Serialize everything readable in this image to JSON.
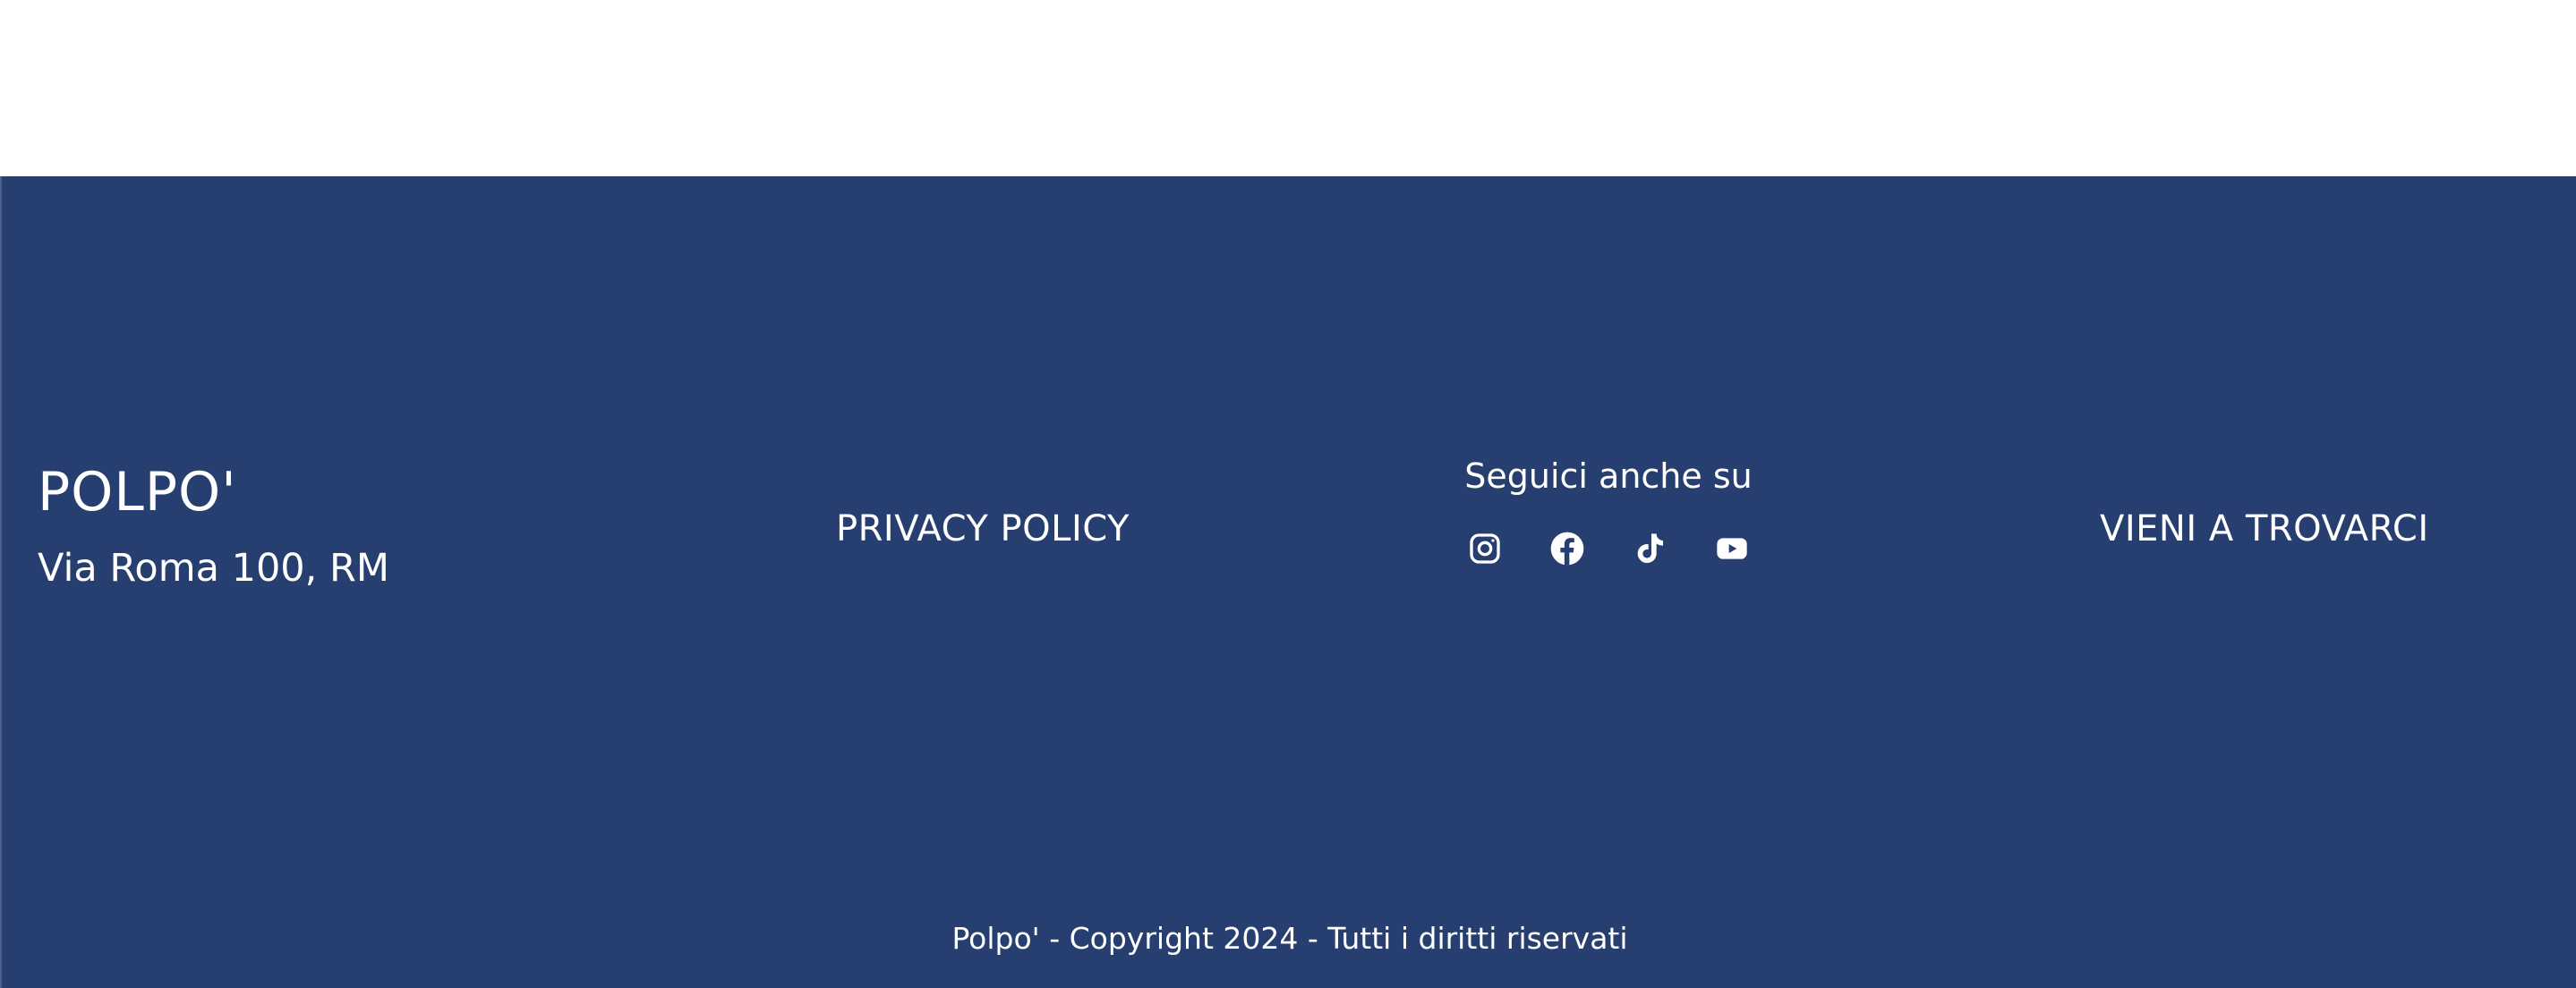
{
  "footer": {
    "brand": {
      "name": "POLPO'",
      "address": "Via Roma 100, RM"
    },
    "privacy_label": "PRIVACY POLICY",
    "social": {
      "title": "Seguici anche su",
      "icons": [
        "instagram-icon",
        "facebook-icon",
        "tiktok-icon",
        "youtube-icon"
      ]
    },
    "visit_label": "VIENI A TROVARCI",
    "copyright": "Polpo' - Copyright 2024 - Tutti i diritti riservati"
  },
  "colors": {
    "footer_bg": "#273f70",
    "text": "#ffffff",
    "page_bg": "#ffffff"
  }
}
